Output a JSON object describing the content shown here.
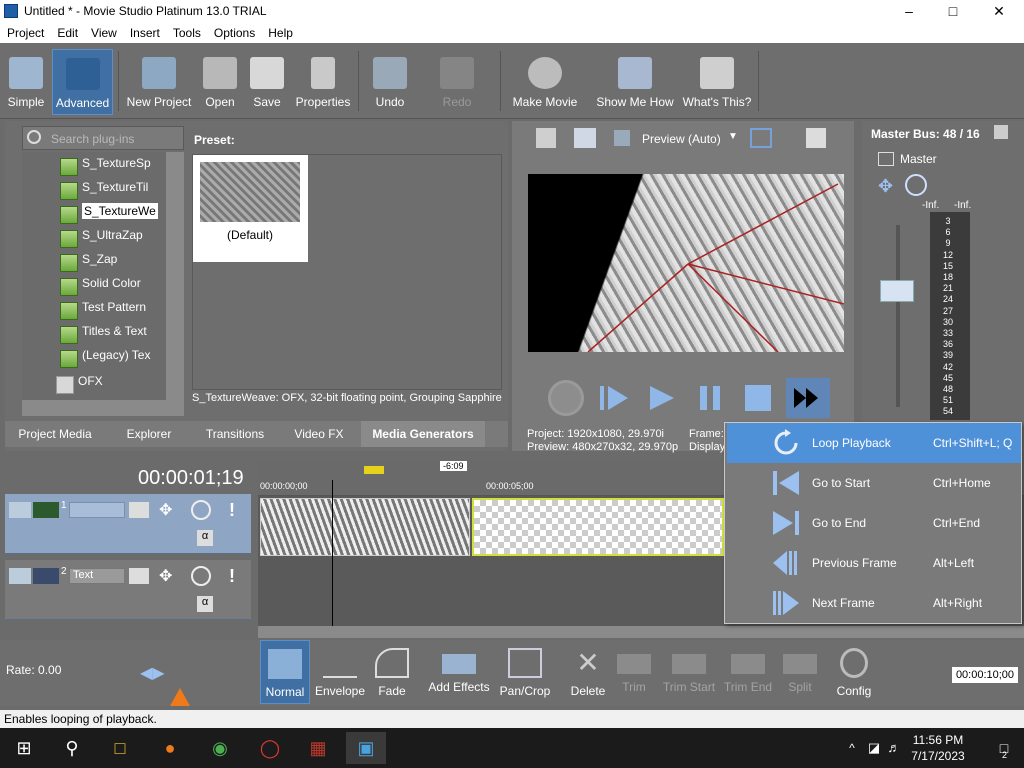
{
  "window": {
    "title": "Untitled * - Movie Studio Platinum 13.0 TRIAL"
  },
  "menu": [
    "Project",
    "Edit",
    "View",
    "Insert",
    "Tools",
    "Options",
    "Help"
  ],
  "toolbar": {
    "simple": "Simple",
    "advanced": "Advanced",
    "new_project": "New Project",
    "open": "Open",
    "save": "Save",
    "properties": "Properties",
    "undo": "Undo",
    "redo": "Redo",
    "make_movie": "Make Movie",
    "show_me_how": "Show Me How",
    "whats_this": "What's This?"
  },
  "plugins": {
    "search_placeholder": "Search plug-ins",
    "items": [
      "S_TextureSp",
      "S_TextureTil",
      "S_TextureWe",
      "S_UltraZap",
      "S_Zap",
      "Solid Color",
      "Test Pattern",
      "Titles & Text",
      "(Legacy) Tex"
    ],
    "folder": "OFX",
    "selected_index": 2
  },
  "preset": {
    "label": "Preset:",
    "default": "(Default)"
  },
  "plugin_info": "S_TextureWeave: OFX, 32-bit floating point, Grouping Sapphire",
  "tabs": [
    "Project Media",
    "Explorer",
    "Transitions",
    "Video FX",
    "Media Generators"
  ],
  "active_tab": "Media Generators",
  "preview": {
    "mode": "Preview (Auto)",
    "project_label": "Project:",
    "project_value": "1920x1080, 29.970i",
    "preview_label": "Preview:",
    "preview_value": "480x270x32, 29.970p",
    "frame_label": "Frame:",
    "display_label": "Display"
  },
  "master": {
    "title": "Master Bus: 48 / 16",
    "label": "Master",
    "meter_left": "-Inf.",
    "meter_right": "-Inf.",
    "scale": [
      "3",
      "6",
      "9",
      "12",
      "15",
      "18",
      "21",
      "24",
      "27",
      "30",
      "33",
      "36",
      "39",
      "42",
      "45",
      "48",
      "51",
      "54"
    ]
  },
  "timeline": {
    "timecode": "00:00:01;19",
    "ruler_start": "00:00:00;00",
    "ruler_mid": "00:00:05;00",
    "marker": "-6:09",
    "track1_num": "1",
    "track2_num": "2",
    "track2_name": "Text"
  },
  "bottom": {
    "rate": "Rate: 0.00",
    "normal": "Normal",
    "envelope": "Envelope",
    "fade": "Fade",
    "add_effects": "Add Effects",
    "pan_crop": "Pan/Crop",
    "delete": "Delete",
    "trim": "Trim",
    "trim_start": "Trim Start",
    "trim_end": "Trim End",
    "split": "Split",
    "config": "Config",
    "end_time": "00:00:10;00"
  },
  "status": "Enables looping of playback.",
  "context_menu": [
    {
      "label": "Loop Playback",
      "shortcut": "Ctrl+Shift+L; Q",
      "icon": "loop-icon"
    },
    {
      "label": "Go to Start",
      "shortcut": "Ctrl+Home",
      "icon": "go-start-icon"
    },
    {
      "label": "Go to End",
      "shortcut": "Ctrl+End",
      "icon": "go-end-icon"
    },
    {
      "label": "Previous Frame",
      "shortcut": "Alt+Left",
      "icon": "prev-frame-icon"
    },
    {
      "label": "Next Frame",
      "shortcut": "Alt+Right",
      "icon": "next-frame-icon"
    }
  ],
  "taskbar": {
    "time": "11:56 PM",
    "date": "7/17/2023",
    "notif": "2"
  },
  "colors": {
    "accent": "#3f6fa3",
    "highlight": "#4f91d9"
  }
}
